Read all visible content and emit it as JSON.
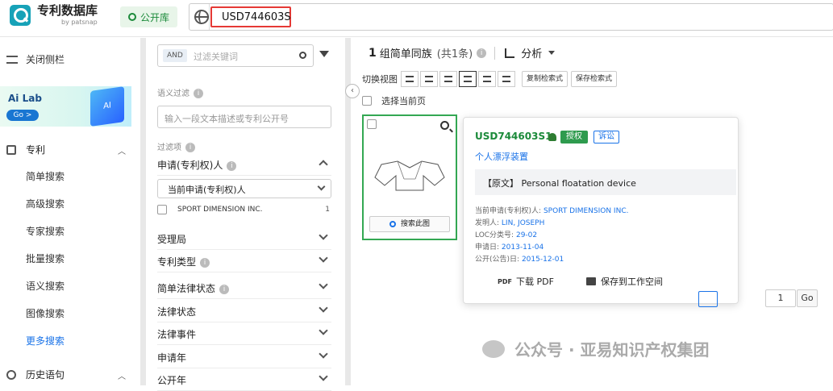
{
  "header": {
    "app_title": "专利数据库",
    "app_subtitle": "by patsnap",
    "db_label": "公开库",
    "query": "USD744603S"
  },
  "sidebar": {
    "collapse_label": "关闭侧栏",
    "ailab_title": "Ai Lab",
    "ailab_go": "Go >",
    "patent_section": "专利",
    "items": [
      "简单搜索",
      "高级搜索",
      "专家搜索",
      "批量搜索",
      "语义搜索",
      "图像搜索",
      "更多搜索"
    ],
    "history_section": "历史语句"
  },
  "filter": {
    "and_tag": "AND",
    "keyword_placeholder": "过滤关键词",
    "semantic_label": "语义过滤",
    "semantic_placeholder": "输入一段文本描述或专利公开号",
    "filter_items_label": "过滤项",
    "applicant_label": "申请(专利权)人",
    "applicant_select": "当前申请(专利权)人",
    "applicant_option": "SPORT DIMENSION INC.",
    "applicant_count": "1",
    "rows": [
      "受理局",
      "专利类型",
      "简单法律状态",
      "法律状态",
      "法律事件",
      "申请年",
      "公开年"
    ]
  },
  "main": {
    "group_count": "1",
    "group_label": "组简单同族",
    "total": "(共1条)",
    "analysis": "分析",
    "switch_view": "切换视图",
    "copy_query": "复制检索式",
    "save_query": "保存检索式",
    "select_page": "选择当前页",
    "search_this_image": "搜索此图",
    "page_input": "1",
    "go": "Go"
  },
  "card": {
    "pub_number": "USD744603S1",
    "status_badge": "授权",
    "litigation_badge": "诉讼",
    "title_cn": "个人漂浮装置",
    "original_title": "【原文】 Personal floatation device",
    "applicant_label": "当前申请(专利权)人:",
    "applicant": "SPORT DIMENSION INC.",
    "inventor_label": "发明人:",
    "inventor": "LIN, JOSEPH",
    "loc_label": "LOC分类号:",
    "loc": "29-02",
    "filing_label": "申请日:",
    "filing_date": "2013-11-04",
    "pub_label": "公开(公告)日:",
    "pub_date": "2015-12-01",
    "pdf_icon_text": "PDF",
    "download_pdf": "下载 PDF",
    "save_workspace": "保存到工作空间"
  },
  "watermark": "公众号 · 亚易知识产权集团",
  "colors": {
    "accent": "#1a73e8",
    "green": "#34a853",
    "red": "#e53935"
  }
}
